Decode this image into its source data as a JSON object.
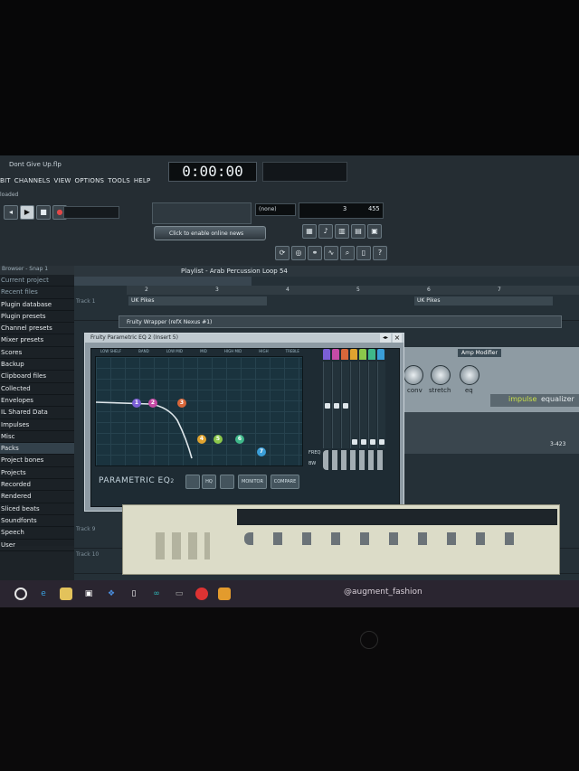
{
  "window": {
    "file_title": "Dont Give Up.flp",
    "status": "loaded"
  },
  "menu": [
    "BIT",
    "CHANNELS",
    "VIEW",
    "OPTIONS",
    "TOOLS",
    "HELP"
  ],
  "transport": {
    "time": "0:00:00",
    "pattern_label": "(none)",
    "tempo_value": "3",
    "tempo_extra": "455"
  },
  "news": {
    "label": "Click to enable online news"
  },
  "browser": {
    "header": "Browser - Snap 1",
    "items": [
      {
        "label": "Current project",
        "type": "folder"
      },
      {
        "label": "Recent files",
        "type": "folder"
      },
      {
        "label": "Plugin database",
        "type": "item"
      },
      {
        "label": "Plugin presets",
        "type": "item"
      },
      {
        "label": "Channel presets",
        "type": "item"
      },
      {
        "label": "Mixer presets",
        "type": "item"
      },
      {
        "label": "Scores",
        "type": "item"
      },
      {
        "label": "Backup",
        "type": "item"
      },
      {
        "label": "Clipboard files",
        "type": "item"
      },
      {
        "label": "Collected",
        "type": "item"
      },
      {
        "label": "Envelopes",
        "type": "item"
      },
      {
        "label": "IL Shared Data",
        "type": "item"
      },
      {
        "label": "Impulses",
        "type": "item"
      },
      {
        "label": "Misc",
        "type": "item"
      },
      {
        "label": "Packs",
        "type": "item",
        "selected": true
      },
      {
        "label": "Project bones",
        "type": "item"
      },
      {
        "label": "Projects",
        "type": "item"
      },
      {
        "label": "Recorded",
        "type": "item"
      },
      {
        "label": "Rendered",
        "type": "item"
      },
      {
        "label": "Sliced beats",
        "type": "item"
      },
      {
        "label": "Soundfonts",
        "type": "item"
      },
      {
        "label": "Speech",
        "type": "item"
      },
      {
        "label": "User",
        "type": "item"
      }
    ]
  },
  "playlist": {
    "title": "Playlist - Arab Percussion Loop 54",
    "ruler": [
      "2",
      "3",
      "4",
      "5",
      "6",
      "7"
    ],
    "clip_a": "UK Pikes",
    "clip_b": "UK Pikes",
    "tracks": [
      "Track 1",
      "Track 9",
      "Track 10"
    ]
  },
  "wrapper": {
    "title": "Fruity Wrapper (refX Nexus #1)"
  },
  "eq": {
    "title": "Fruity Parametric EQ 2 (Insert 5)",
    "band_labels": [
      "LOW SHELF",
      "BAND",
      "LOW MID",
      "MID",
      "HIGH MID",
      "HIGH",
      "TREBLE"
    ],
    "node_labels": [
      "1",
      "2",
      "3",
      "4",
      "5",
      "6",
      "7"
    ],
    "freq_label": "FREQ",
    "bw_label": "BW",
    "brand": "PARAMETRIC EQ",
    "brand_sub": "2",
    "hq_label": "HQ",
    "monitor_label": "MONITOR",
    "compare_label": "COMPARE",
    "colors": {
      "n1": "#7b5fd6",
      "n2": "#c64ba6",
      "n3": "#d8673a",
      "n4": "#e0a32f",
      "n5": "#8cc84b",
      "n6": "#3fb88a",
      "n7": "#3a9ed8"
    }
  },
  "nexus": {
    "knob1": "conv",
    "knob2": "stretch",
    "knob3": "eq",
    "module": "Amp Modifier",
    "brand": "impulse",
    "brand2": "equalizer",
    "readout": "3-423"
  },
  "taskbar": {
    "account": "@augment_fashion"
  }
}
